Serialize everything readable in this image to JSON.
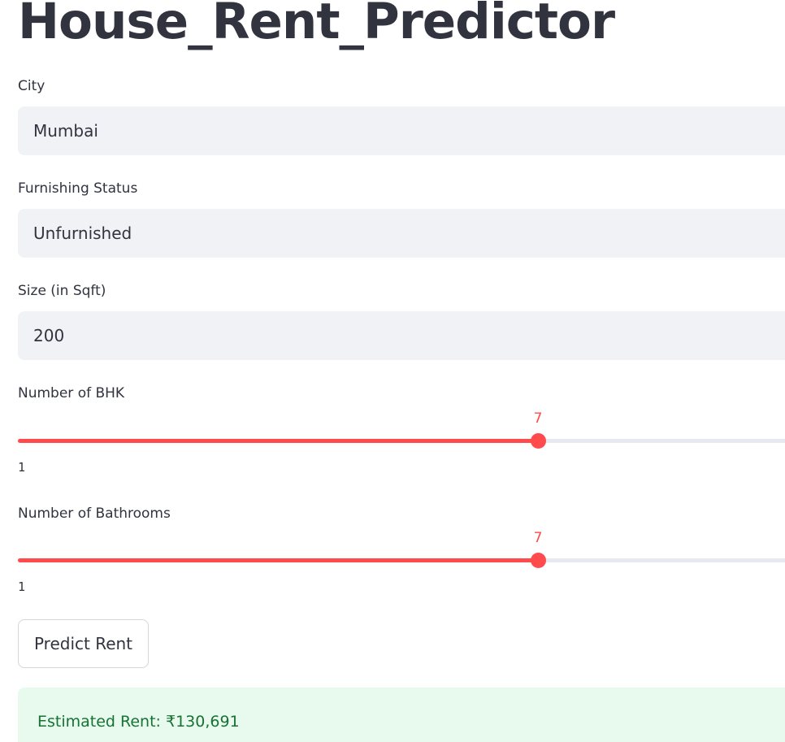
{
  "app": {
    "title": "House_Rent_Predictor"
  },
  "form": {
    "city": {
      "label": "City",
      "value": "Mumbai"
    },
    "furnishing": {
      "label": "Furnishing Status",
      "value": "Unfurnished"
    },
    "size": {
      "label": "Size (in Sqft)",
      "value": "200"
    },
    "bhk": {
      "label": "Number of BHK",
      "value": "7",
      "min": "1",
      "max": 10
    },
    "bathrooms": {
      "label": "Number of Bathrooms",
      "value": "7",
      "min": "1",
      "max": 10
    },
    "predict_label": "Predict Rent"
  },
  "result": {
    "text": "Estimated Rent: ₹130,691"
  },
  "colors": {
    "accent": "#ff4b4b",
    "success_bg": "#e8f9ee",
    "success_text": "#177233",
    "input_bg": "#f0f2f6"
  }
}
